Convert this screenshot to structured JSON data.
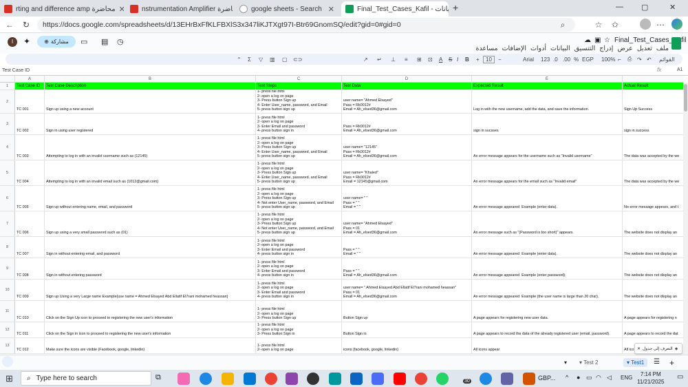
{
  "tabs": [
    {
      "label": "rting and difference amp محاضرة",
      "color": "#d93025"
    },
    {
      "label": "nstrumentation Amplifier محاضرة",
      "color": "#d93025"
    },
    {
      "label": "google sheets - Search",
      "color": "#555"
    },
    {
      "label": "Final_Test_Cases_Kafil - جداول بيانات",
      "color": "#0f9d58"
    }
  ],
  "new_tab": "+",
  "url": "https://docs.google.com/spreadsheets/d/13EHrBxFfKLFBXlS3x347liKJTXgt97I-Btr69GnomSQ/edit?gid=0#gid=0",
  "doc": {
    "title": "Final_Test_Cases_Kafil",
    "share": "مشاركة",
    "avatar": "I"
  },
  "menu": [
    "ملف",
    "تعديل",
    "عرض",
    "إدراج",
    "التنسيق",
    "البيانات",
    "أدوات",
    "الإضافات",
    "مساعدة"
  ],
  "toolbar": {
    "font": "Arial",
    "size": "10",
    "zoom": "100%",
    "currency": "EGP",
    "formats": "123",
    "mode": "القوائم"
  },
  "name_box": "Test Case ID",
  "fx": "fx",
  "fx_value": "A1",
  "columns": [
    "A",
    "B",
    "C",
    "D",
    "E",
    "F"
  ],
  "header": [
    "Test Case ID",
    "Test Case Description",
    "Test Steps",
    "Test Data",
    "Expected Result",
    "Actual Result"
  ],
  "rows": [
    {
      "n": "2",
      "id": "TC 001",
      "desc": "Sign up using a new account",
      "steps": "1- press file html\n2- open a log on page\n3- Press button Sign up\n4- Enter User_name, password, and Email\n5- press button sign up",
      "data": "user name= \"Ahmed Elsayed\"\nPass = Rk0012#\nEmail = Ah_elsed36@gmail.com",
      "exp": "Log in with the new username, add the data, and save the information.",
      "act": "Sign Up Success"
    },
    {
      "n": "3",
      "id": "TC 002",
      "desc": "Sign in using user registered",
      "steps": "1- press file html\n2- open a log on page\n3- Enter Email and password\n4- press button sign in",
      "data": "Pass = Rk0012#\nEmail = Ah_elsed36@gmail.com",
      "exp": "sign in sucsses",
      "act": "sign in success"
    },
    {
      "n": "4",
      "id": "TC 003",
      "desc": "Attempting to log in with an invalid username such as (12145)",
      "steps": "1- press file html\n2- open a log on page\n3- Press button Sign up\n4- Enter User_name, password, and Email\n5- press button sign up",
      "data": "user name= \"12145\"\nPass = Rk0012#\nEmail = Ah_elsed36@gmail.com",
      "exp": "An error message appears for the username such as \"Invalid username\"",
      "act": "The data was accepted by the we"
    },
    {
      "n": "5",
      "id": "TC 004",
      "desc": "Attempting to log in with an invalid email such as (1012@gmail.com)",
      "steps": "1- press file html\n2- open a log on page\n3- Press button Sign up\n4- Enter User_name, password, and Email\n5- press button sign up",
      "data": "user name= \"Khaled\"\nPass = Rk0012#\nEmail = 12145@gmail.com",
      "exp": "An error message appears for the email such as \"Invalid email\"",
      "act": "The data was accepted by the we"
    },
    {
      "n": "6",
      "id": "TC 005",
      "desc": "Sign up without entering name, email, and password",
      "steps": "1- press file html\n2- open a log on page\n3- Press button Sign up\n4- Not enter User_name, password, and Email\n5- press button sign up",
      "data": "user name= \" \"\nPass = \" \"\nEmail = \" \"",
      "exp": "An error message appeared  Example (enter data).",
      "act": "No error message appears, and t"
    },
    {
      "n": "7",
      "id": "TC 006",
      "desc": "Sign up using a very small password such as (01)",
      "steps": "1- press file html\n2- open a log on page\n3- Press button Sign up\n4- Not enter User_name, password, and Email\n5- press button sign up",
      "data": "user name= \"Ahmed Elsayed\"\nPass = 01\nEmail = Ah_elsed36@gmail.com",
      "exp": "An error message such as \"(Password is too short)\" appears.",
      "act": "The website does not display an"
    },
    {
      "n": "8",
      "id": "TC 007",
      "desc": "Sign in without entering email, and password",
      "steps": "1- press file html\n2- open a log on page\n3- Enter Email and password\n4- press button sign in",
      "data": "Pass = \" \"\nEmail = \" \"",
      "exp": "An error message appeared  Example (enter data).",
      "act": "The website does not display an"
    },
    {
      "n": "9",
      "id": "TC 008",
      "desc": "Sign in without entering password",
      "steps": "1- press file html\n2- open a log on page\n3- Enter Email and password\n4- press button sign in",
      "data": "Pass = \" \"\nEmail = Ah_elsed36@gmail.com",
      "exp": "An error message appeared  Example (enter password).",
      "act": "The website does not display an"
    },
    {
      "n": "10",
      "id": "TC 009",
      "desc": "Sign up Using a very Large name Example(use name = Ahmed Elsayed Abd Ellatif El7rani mohamed heassan)",
      "steps": "1- press file html\n2- open a log on page\n3- Enter Email and password\n4- press button sign in",
      "data": "user name= \" Ahmed Elsayed Abd Ellatif El7rani mohamed heassan\"\nPass = 01\nEmail = Ah_elsed36@gmail.com",
      "exp": "An error message appeared  Example (the user name is large than 20 char).",
      "act": "The website does not display an"
    },
    {
      "n": "11",
      "id": "TC 010",
      "desc": "Click on the Sign Up icon to proceed to registering the new user's information",
      "steps": "1- press file html\n2- open a log on page\n3- Press button Sign up",
      "data": "Button Sign up",
      "exp": "A page appears for registering new user data.",
      "act": "A page appears for registering n"
    },
    {
      "n": "12",
      "id": "TC 011",
      "desc": "Click on the Sign in icon to proceed to registering the new user's information",
      "steps": "1- press file html\n2- open a log on page\n3- Press button Sign in",
      "data": "Button Sign in",
      "exp": "A page appears to record the data of the already registered user (email, password).",
      "act": "A page appears to record the dat"
    },
    {
      "n": "13",
      "id": "TC 012",
      "desc": "Make sure the icons are visible (Facebook, google, linkedin)",
      "steps": "1- press file html\n2- open a log on page",
      "data": "icons (facebook, google, linkedin)",
      "exp": "All icons appear",
      "act": "All ico"
    }
  ],
  "sheet_tabs": [
    "Test 2",
    "Test1"
  ],
  "toast": "التعرف إلى جدول",
  "taskbar": {
    "search": "Type here to search",
    "time": "7:14 PM",
    "date": "11/21/2025",
    "lang": "ENG",
    "currency": "GBP...",
    "badge": "30"
  }
}
